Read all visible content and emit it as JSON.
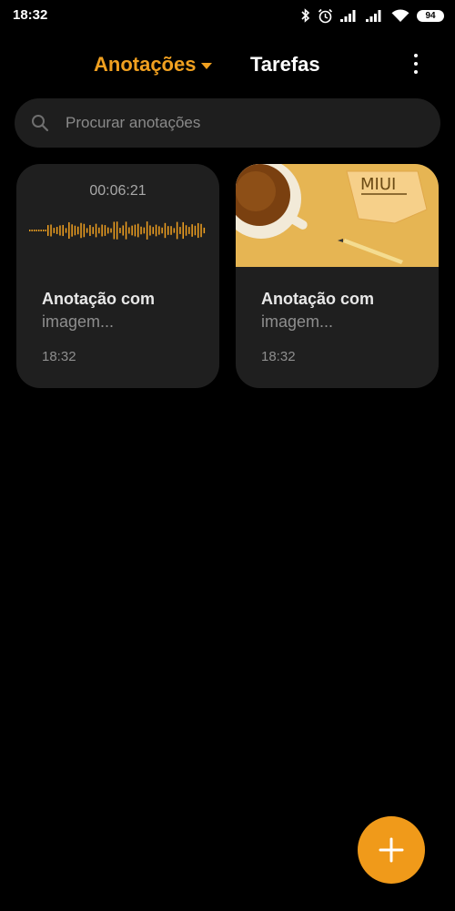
{
  "status_bar": {
    "time": "18:32",
    "battery": "94",
    "icons": [
      "bluetooth-icon",
      "alarm-icon",
      "signal-icon",
      "signal-icon",
      "wifi-icon",
      "battery-icon"
    ]
  },
  "header": {
    "tabs": [
      {
        "label": "Anotações",
        "active": true
      },
      {
        "label": "Tarefas",
        "active": false
      }
    ],
    "more_icon": "more-vertical-icon"
  },
  "search": {
    "placeholder": "Procurar anotações",
    "value": ""
  },
  "notes": [
    {
      "type": "audio",
      "duration": "00:06:21",
      "title": "Anotação com",
      "subtitle": "imagem...",
      "time": "18:32"
    },
    {
      "type": "image",
      "image_text": "MIUI",
      "title": "Anotação com",
      "subtitle": "imagem...",
      "time": "18:32"
    }
  ],
  "fab": {
    "icon": "plus-icon"
  },
  "colors": {
    "accent": "#f0a020",
    "background": "#000000",
    "card": "#1f1f1f",
    "fab": "#f09a1a"
  }
}
